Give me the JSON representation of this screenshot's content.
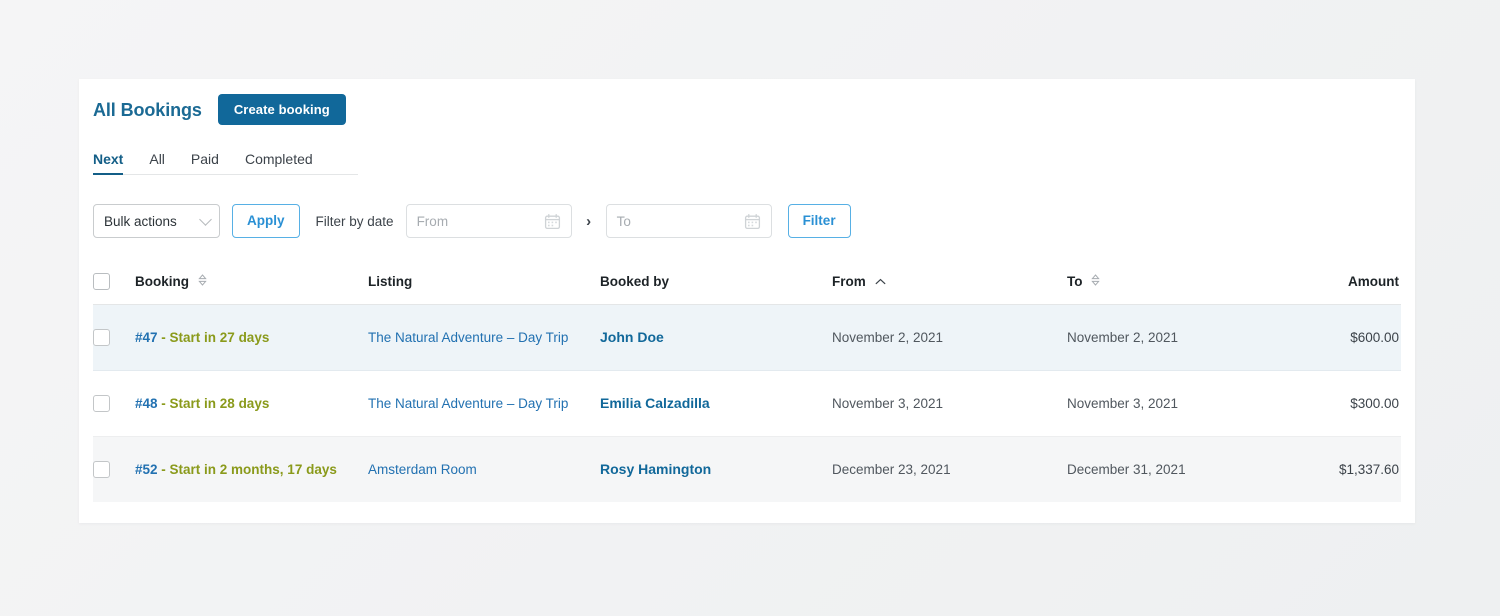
{
  "header": {
    "title": "All Bookings",
    "create_button": "Create booking"
  },
  "tabs": [
    {
      "label": "Next",
      "active": true
    },
    {
      "label": "All",
      "active": false
    },
    {
      "label": "Paid",
      "active": false
    },
    {
      "label": "Completed",
      "active": false
    }
  ],
  "filterbar": {
    "bulk_actions_value": "Bulk actions",
    "apply_label": "Apply",
    "filter_by_date_label": "Filter by date",
    "from_placeholder": "From",
    "from_value": "",
    "to_placeholder": "To",
    "to_value": "",
    "range_separator": "›",
    "filter_label": "Filter"
  },
  "table": {
    "columns": [
      {
        "key": "checkbox",
        "label": "",
        "sort": "none"
      },
      {
        "key": "booking",
        "label": "Booking",
        "sort": "unsorted"
      },
      {
        "key": "listing",
        "label": "Listing",
        "sort": "none"
      },
      {
        "key": "booked_by",
        "label": "Booked by",
        "sort": "none"
      },
      {
        "key": "from",
        "label": "From",
        "sort": "asc"
      },
      {
        "key": "to",
        "label": "To",
        "sort": "unsorted"
      },
      {
        "key": "amount",
        "label": "Amount",
        "sort": "none"
      }
    ],
    "rows": [
      {
        "booking_id": "#47",
        "booking_relative": "- Start in 27 days",
        "listing": "The Natural Adventure – Day Trip",
        "booked_by": "John Doe",
        "from": "November 2, 2021",
        "to": "November 2, 2021",
        "amount": "$600.00"
      },
      {
        "booking_id": "#48",
        "booking_relative": "- Start in 28 days",
        "listing": "The Natural Adventure – Day Trip",
        "booked_by": "Emilia Calzadilla",
        "from": "November 3, 2021",
        "to": "November 3, 2021",
        "amount": "$300.00"
      },
      {
        "booking_id": "#52",
        "booking_relative": "- Start in 2 months, 17 days",
        "listing": "Amsterdam Room",
        "booked_by": "Rosy Hamington",
        "from": "December 23, 2021",
        "to": "December 31, 2021",
        "amount": "$1,337.60"
      }
    ]
  },
  "colors": {
    "brand": "#11689a",
    "link": "#2271b1",
    "accent_green": "#8a9a1b",
    "outline_blue": "#57b0e5",
    "row_highlight": "#eef4f8",
    "row_alt": "#f5f6f7"
  }
}
